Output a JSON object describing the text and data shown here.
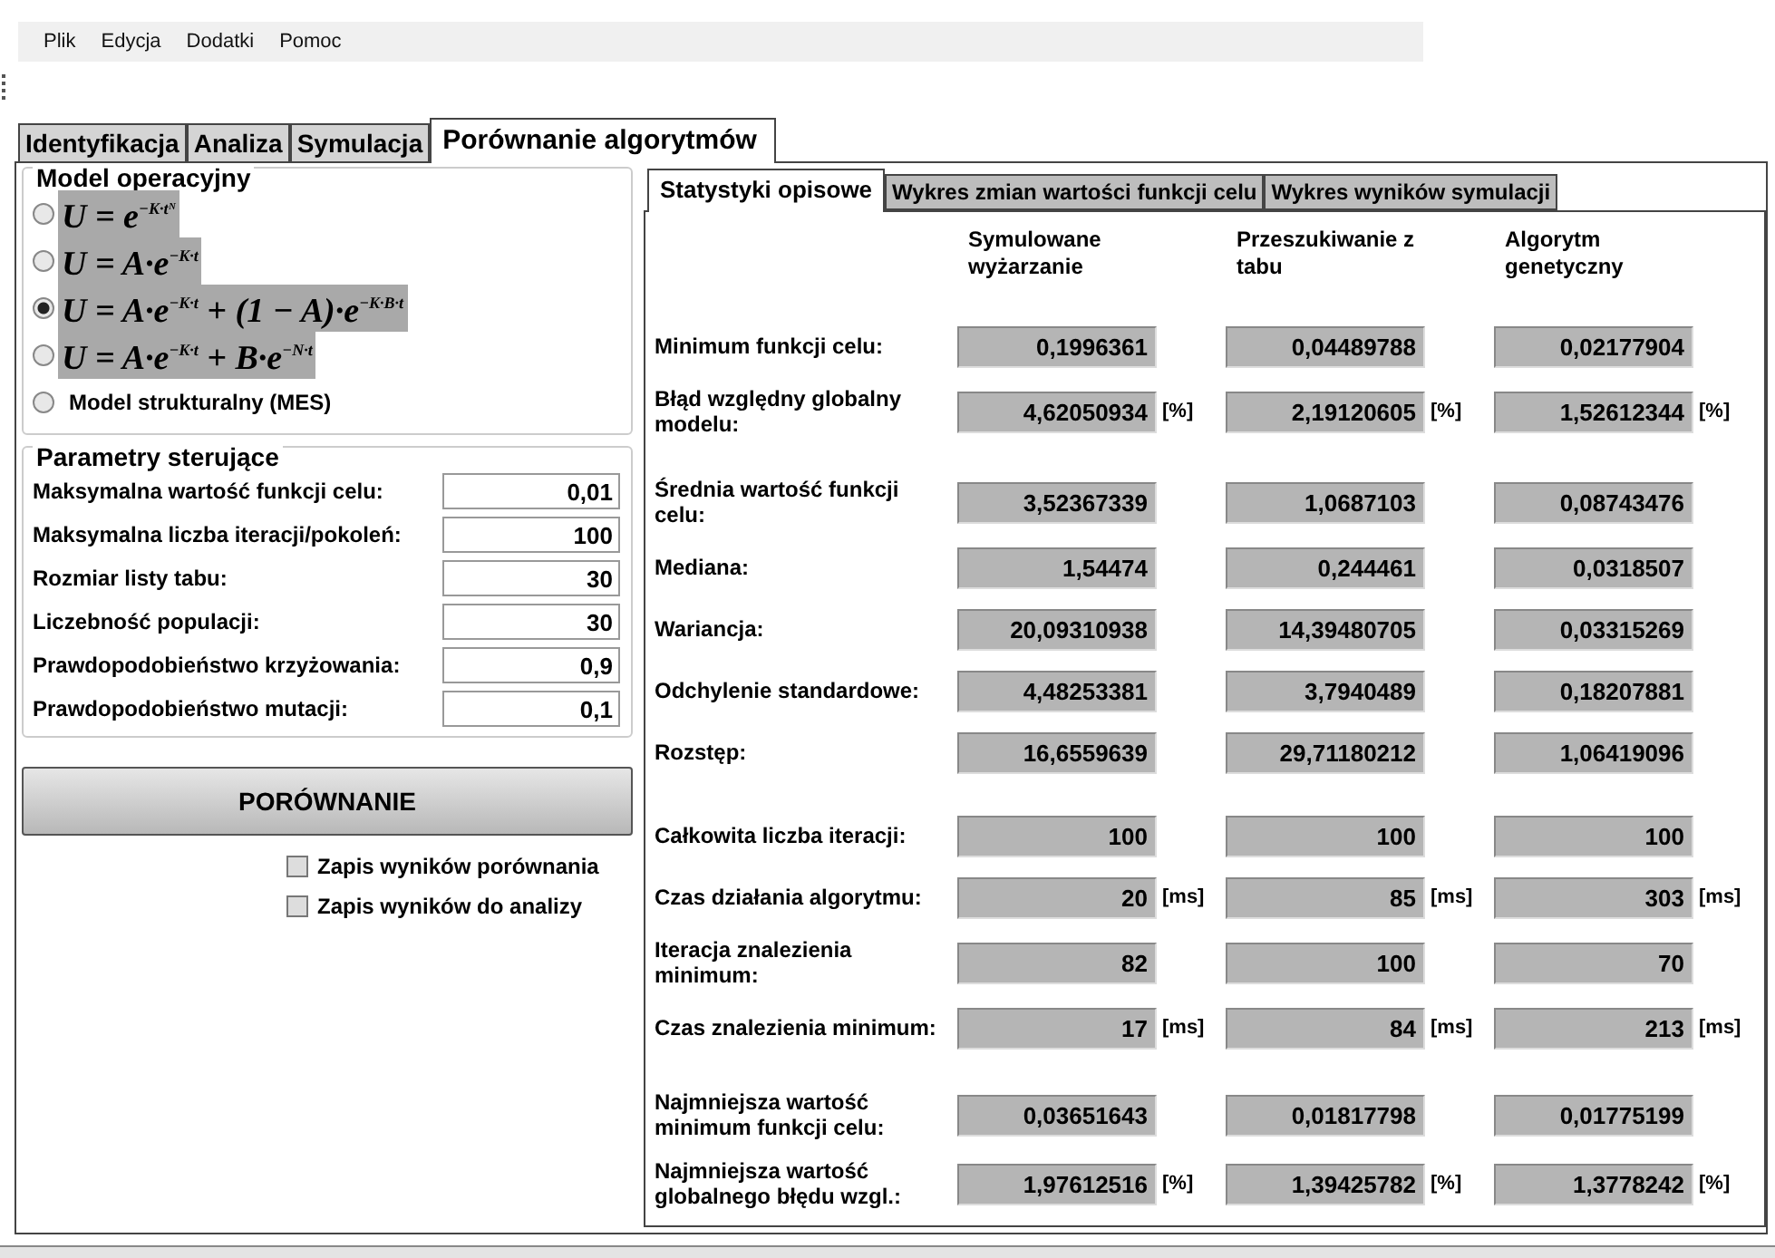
{
  "menu": [
    "Plik",
    "Edycja",
    "Dodatki",
    "Pomoc"
  ],
  "tabs": [
    {
      "label": "Identyfikacja",
      "selected": false
    },
    {
      "label": "Analiza",
      "selected": false
    },
    {
      "label": "Symulacja",
      "selected": false
    },
    {
      "label": "Porównanie algorytmów",
      "selected": true
    }
  ],
  "model_group": {
    "title": "Model operacyjny",
    "options": [
      {
        "kind": "formula",
        "label": "U = e$^{−K·tᴺ}$",
        "selected": false
      },
      {
        "kind": "formula",
        "label": "U = A·e$^{−K·t}$",
        "selected": false
      },
      {
        "kind": "formula",
        "label": "U = A·e$^{−K·t}$ + (1 − A)·e$^{−K·B·t}$",
        "selected": true
      },
      {
        "kind": "formula",
        "label": "U = A·e$^{−K·t}$ + B·e$^{−N·t}$",
        "selected": false
      },
      {
        "kind": "text",
        "label": "Model strukturalny (MES)",
        "selected": false
      }
    ]
  },
  "params_group": {
    "title": "Parametry sterujące",
    "fields": [
      {
        "label": "Maksymalna wartość funkcji celu:",
        "value": "0,01"
      },
      {
        "label": "Maksymalna liczba iteracji/pokoleń:",
        "value": "100"
      },
      {
        "label": "Rozmiar listy tabu:",
        "value": "30"
      },
      {
        "label": "Liczebność populacji:",
        "value": "30"
      },
      {
        "label": "Prawdopodobieństwo krzyżowania:",
        "value": "0,9"
      },
      {
        "label": "Prawdopodobieństwo mutacji:",
        "value": "0,1"
      }
    ]
  },
  "compare_button": "PORÓWNANIE",
  "checkboxes": [
    {
      "label": "Zapis wyników porównania",
      "checked": false
    },
    {
      "label": "Zapis wyników do analizy",
      "checked": false
    }
  ],
  "sub_tabs": [
    {
      "label": "Statystyki opisowe",
      "selected": true
    },
    {
      "label": "Wykres zmian wartości funkcji celu",
      "selected": false
    },
    {
      "label": "Wykres wyników symulacji",
      "selected": false
    }
  ],
  "stats": {
    "columns": [
      "Symulowane wyżarzanie",
      "Przeszukiwanie z tabu",
      "Algorytm genetyczny"
    ],
    "sections": [
      [
        {
          "label": "Minimum funkcji celu:",
          "cells": [
            {
              "value": "0,1996361"
            },
            {
              "value": "0,04489788"
            },
            {
              "value": "0,02177904"
            }
          ]
        },
        {
          "label": "Błąd względny globalny modelu:",
          "cells": [
            {
              "value": "4,62050934",
              "unit": "[%]"
            },
            {
              "value": "2,19120605",
              "unit": "[%]"
            },
            {
              "value": "1,52612344",
              "unit": "[%]"
            }
          ]
        }
      ],
      [
        {
          "label": "Średnia wartość funkcji celu:",
          "cells": [
            {
              "value": "3,52367339"
            },
            {
              "value": "1,0687103"
            },
            {
              "value": "0,08743476"
            }
          ]
        },
        {
          "label": "Mediana:",
          "cells": [
            {
              "value": "1,54474"
            },
            {
              "value": "0,244461"
            },
            {
              "value": "0,0318507"
            }
          ]
        },
        {
          "label": "Wariancja:",
          "cells": [
            {
              "value": "20,09310938"
            },
            {
              "value": "14,39480705"
            },
            {
              "value": "0,03315269"
            }
          ]
        },
        {
          "label": "Odchylenie standardowe:",
          "cells": [
            {
              "value": "4,48253381"
            },
            {
              "value": "3,7940489"
            },
            {
              "value": "0,18207881"
            }
          ]
        },
        {
          "label": "Rozstęp:",
          "cells": [
            {
              "value": "16,6559639"
            },
            {
              "value": "29,71180212"
            },
            {
              "value": "1,06419096"
            }
          ]
        }
      ],
      [
        {
          "label": "Całkowita liczba iteracji:",
          "cells": [
            {
              "value": "100"
            },
            {
              "value": "100"
            },
            {
              "value": "100"
            }
          ]
        },
        {
          "label": "Czas działania algorytmu:",
          "cells": [
            {
              "value": "20",
              "unit": "[ms]"
            },
            {
              "value": "85",
              "unit": "[ms]"
            },
            {
              "value": "303",
              "unit": "[ms]"
            }
          ]
        },
        {
          "label": "Iteracja znalezienia minimum:",
          "cells": [
            {
              "value": "82"
            },
            {
              "value": "100"
            },
            {
              "value": "70"
            }
          ]
        },
        {
          "label": "Czas znalezienia minimum:",
          "cells": [
            {
              "value": "17",
              "unit": "[ms]"
            },
            {
              "value": "84",
              "unit": "[ms]"
            },
            {
              "value": "213",
              "unit": "[ms]"
            }
          ]
        }
      ],
      [
        {
          "label": "Najmniejsza wartość minimum funkcji celu:",
          "cells": [
            {
              "value": "0,03651643"
            },
            {
              "value": "0,01817798"
            },
            {
              "value": "0,01775199"
            }
          ]
        },
        {
          "label": "Najmniejsza wartość globalnego błędu wzgl.:",
          "cells": [
            {
              "value": "1,97612516",
              "unit": "[%]"
            },
            {
              "value": "1,39425782",
              "unit": "[%]"
            },
            {
              "value": "1,3778242",
              "unit": "[%]"
            }
          ]
        }
      ]
    ]
  }
}
